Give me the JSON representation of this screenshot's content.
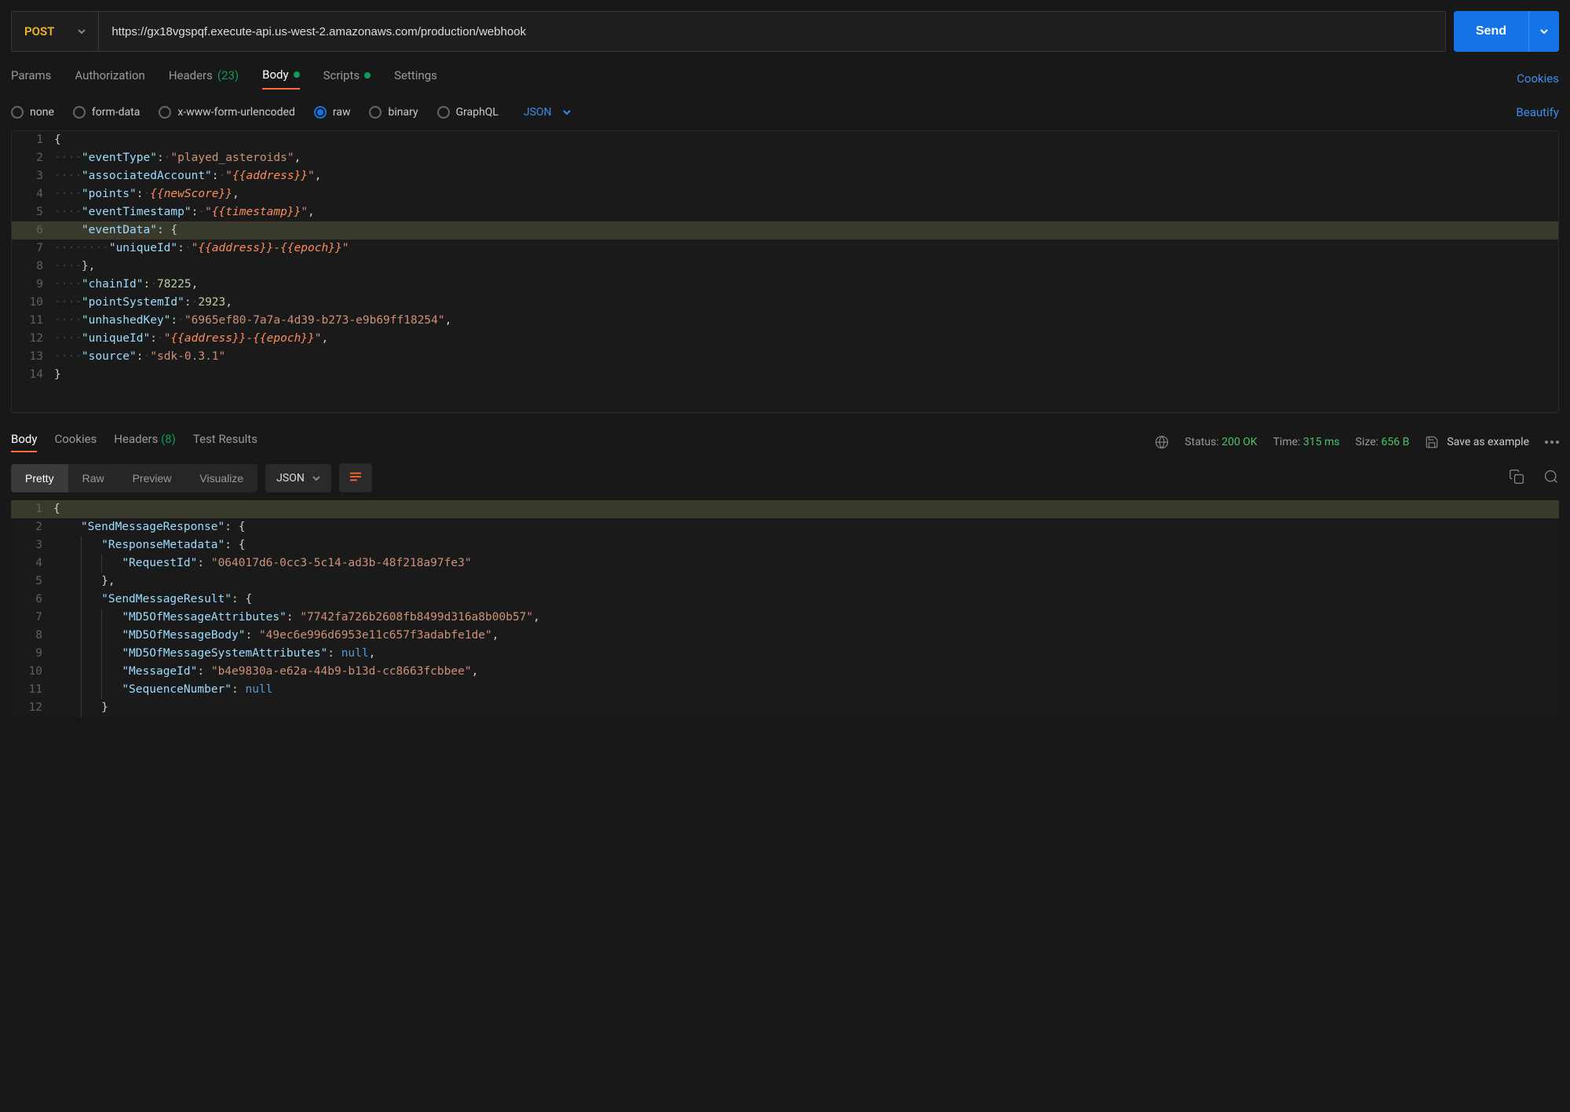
{
  "request": {
    "method": "POST",
    "url": "https://gx18vgspqf.execute-api.us-west-2.amazonaws.com/production/webhook",
    "send_label": "Send"
  },
  "tabs": {
    "params": "Params",
    "authorization": "Authorization",
    "headers": "Headers",
    "headers_count": "(23)",
    "body": "Body",
    "scripts": "Scripts",
    "settings": "Settings",
    "cookies": "Cookies"
  },
  "body_types": {
    "none": "none",
    "form_data": "form-data",
    "urlencoded": "x-www-form-urlencoded",
    "raw": "raw",
    "binary": "binary",
    "graphql": "GraphQL",
    "json": "JSON",
    "beautify": "Beautify"
  },
  "request_body": {
    "eventType": "played_asteroids",
    "associatedAccount_var": "{{address}}",
    "points_var": "{{newScore}}",
    "eventTimestamp_var": "{{timestamp}}",
    "eventData_uniqueId_var": "{{address}}-{{epoch}}",
    "chainId": 78225,
    "pointSystemId": 2923,
    "unhashedKey": "6965ef80-7a7a-4d39-b273-e9b69ff18254",
    "uniqueId_var": "{{address}}-{{epoch}}",
    "source": "sdk-0.3.1"
  },
  "response_tabs": {
    "body": "Body",
    "cookies": "Cookies",
    "headers": "Headers",
    "headers_count": "(8)",
    "test_results": "Test Results"
  },
  "response_meta": {
    "status_label": "Status:",
    "status_code": "200 OK",
    "time_label": "Time:",
    "time_value": "315 ms",
    "size_label": "Size:",
    "size_value": "656 B",
    "save_example": "Save as example"
  },
  "view_modes": {
    "pretty": "Pretty",
    "raw": "Raw",
    "preview": "Preview",
    "visualize": "Visualize",
    "format": "JSON"
  },
  "response_body": {
    "RequestId": "064017d6-0cc3-5c14-ad3b-48f218a97fe3",
    "MD5OfMessageAttributes": "7742fa726b2608fb8499d316a8b00b57",
    "MD5OfMessageBody": "49ec6e996d6953e11c657f3adabfe1de",
    "MD5OfMessageSystemAttributes": "null",
    "MessageId": "b4e9830a-e62a-44b9-b13d-cc8663fcbbee",
    "SequenceNumber": "null"
  }
}
